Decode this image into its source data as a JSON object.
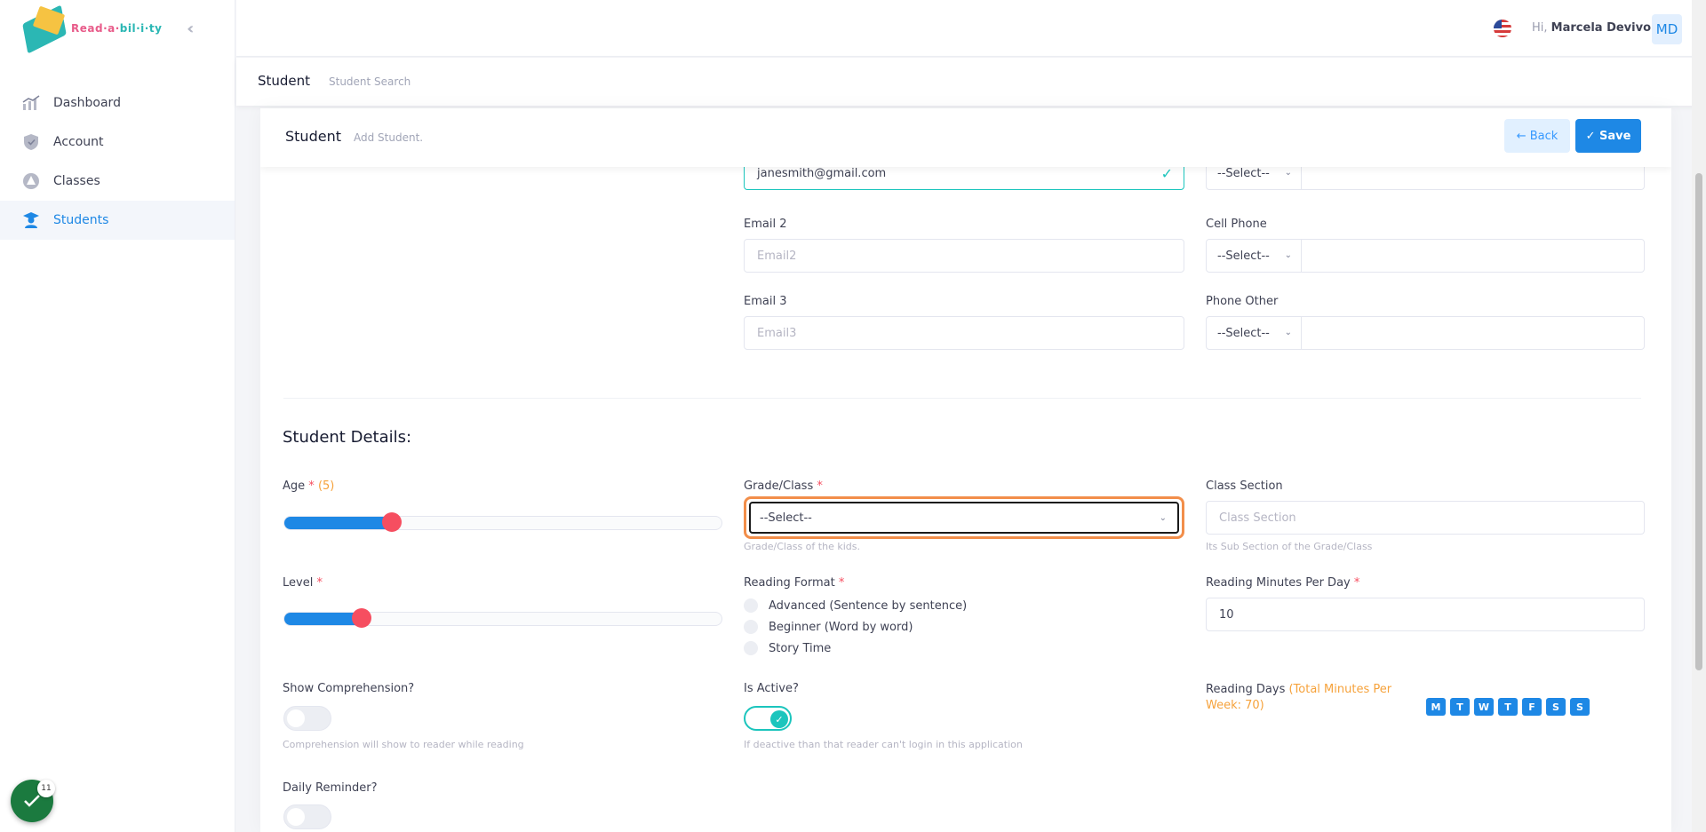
{
  "brand": {
    "name_part1": "Read·a·",
    "name_part2": "bil·i·ty"
  },
  "sidebar": {
    "items": [
      {
        "label": "Dashboard",
        "icon": "chart-icon"
      },
      {
        "label": "Account",
        "icon": "shield-icon"
      },
      {
        "label": "Classes",
        "icon": "classes-icon"
      },
      {
        "label": "Students",
        "icon": "student-icon",
        "active": true
      }
    ]
  },
  "header": {
    "greeting": "Hi,",
    "user_name": "Marcela Devivo",
    "avatar_initials": "MD"
  },
  "subheader": {
    "title": "Student",
    "subtitle": "Student Search"
  },
  "card": {
    "title": "Student",
    "subtitle": "Add Student.",
    "back_label": "← Back",
    "save_label": "✓ Save"
  },
  "contact": {
    "email1_value": "janesmith@gmail.com",
    "email2_label": "Email 2",
    "email2_placeholder": "Email2",
    "email3_label": "Email 3",
    "email3_placeholder": "Email3",
    "phone_top_select": "--Select--",
    "cell_phone_label": "Cell Phone",
    "cell_phone_select": "--Select--",
    "phone_other_label": "Phone Other",
    "phone_other_select": "--Select--"
  },
  "details": {
    "section_title": "Student Details:",
    "age_label": "Age",
    "age_value": "(5)",
    "age_fraction": 0.24,
    "grade_label": "Grade/Class",
    "grade_value": "--Select--",
    "grade_hint": "Grade/Class of the kids.",
    "class_section_label": "Class Section",
    "class_section_placeholder": "Class Section",
    "class_section_hint": "Its Sub Section of the Grade/Class",
    "level_label": "Level",
    "level_fraction": 0.17,
    "reading_format_label": "Reading Format",
    "reading_format_options": [
      "Advanced (Sentence by sentence)",
      "Beginner (Word by word)",
      "Story Time"
    ],
    "minutes_label": "Reading Minutes Per Day",
    "minutes_value": "10",
    "show_comp_label": "Show Comprehension?",
    "show_comp_hint": "Comprehension will show to reader while reading",
    "is_active_label": "Is Active?",
    "is_active_hint": "If deactive than that reader can't login in this application",
    "reading_days_label": "Reading Days",
    "reading_days_total": "(Total Minutes Per Week: 70)",
    "days": [
      "M",
      "T",
      "W",
      "T",
      "F",
      "S",
      "S"
    ],
    "daily_reminder_label": "Daily Reminder?"
  },
  "fab": {
    "badge": "11"
  },
  "colors": {
    "primary": "#1e88e5",
    "accent": "#1bc5bd",
    "danger": "#f64e60",
    "highlight": "#f28e4a"
  }
}
